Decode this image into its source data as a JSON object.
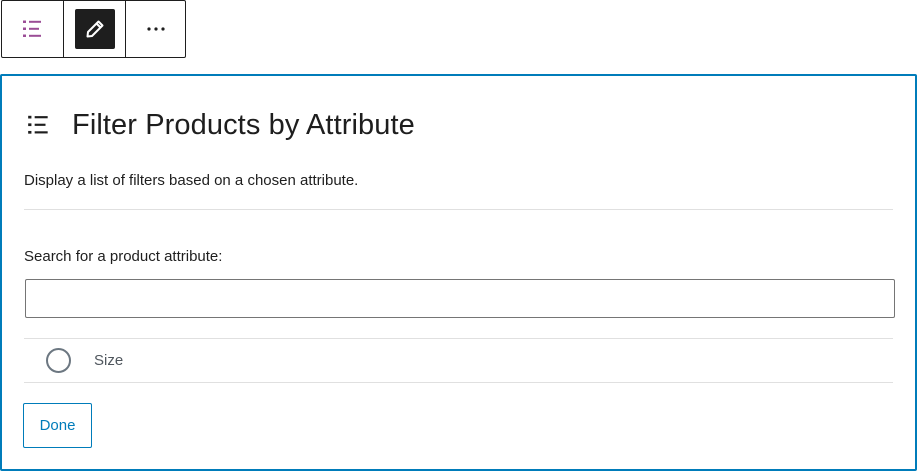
{
  "toolbar": {
    "block_type_icon": "list-icon",
    "edit_icon": "pencil-icon",
    "more_icon": "more-horizontal-icon",
    "more_label": "⋯"
  },
  "panel": {
    "icon": "list-icon",
    "title": "Filter Products by Attribute",
    "description": "Display a list of filters based on a chosen attribute.",
    "search": {
      "label": "Search for a product attribute:",
      "value": "",
      "placeholder": ""
    },
    "options": [
      {
        "label": "Size",
        "selected": false
      }
    ],
    "done_label": "Done"
  },
  "colors": {
    "accent": "#007cba",
    "toolbar_icon_purple": "#9b4d96",
    "dark": "#1e1e1e",
    "radio_border": "#6c7781"
  }
}
